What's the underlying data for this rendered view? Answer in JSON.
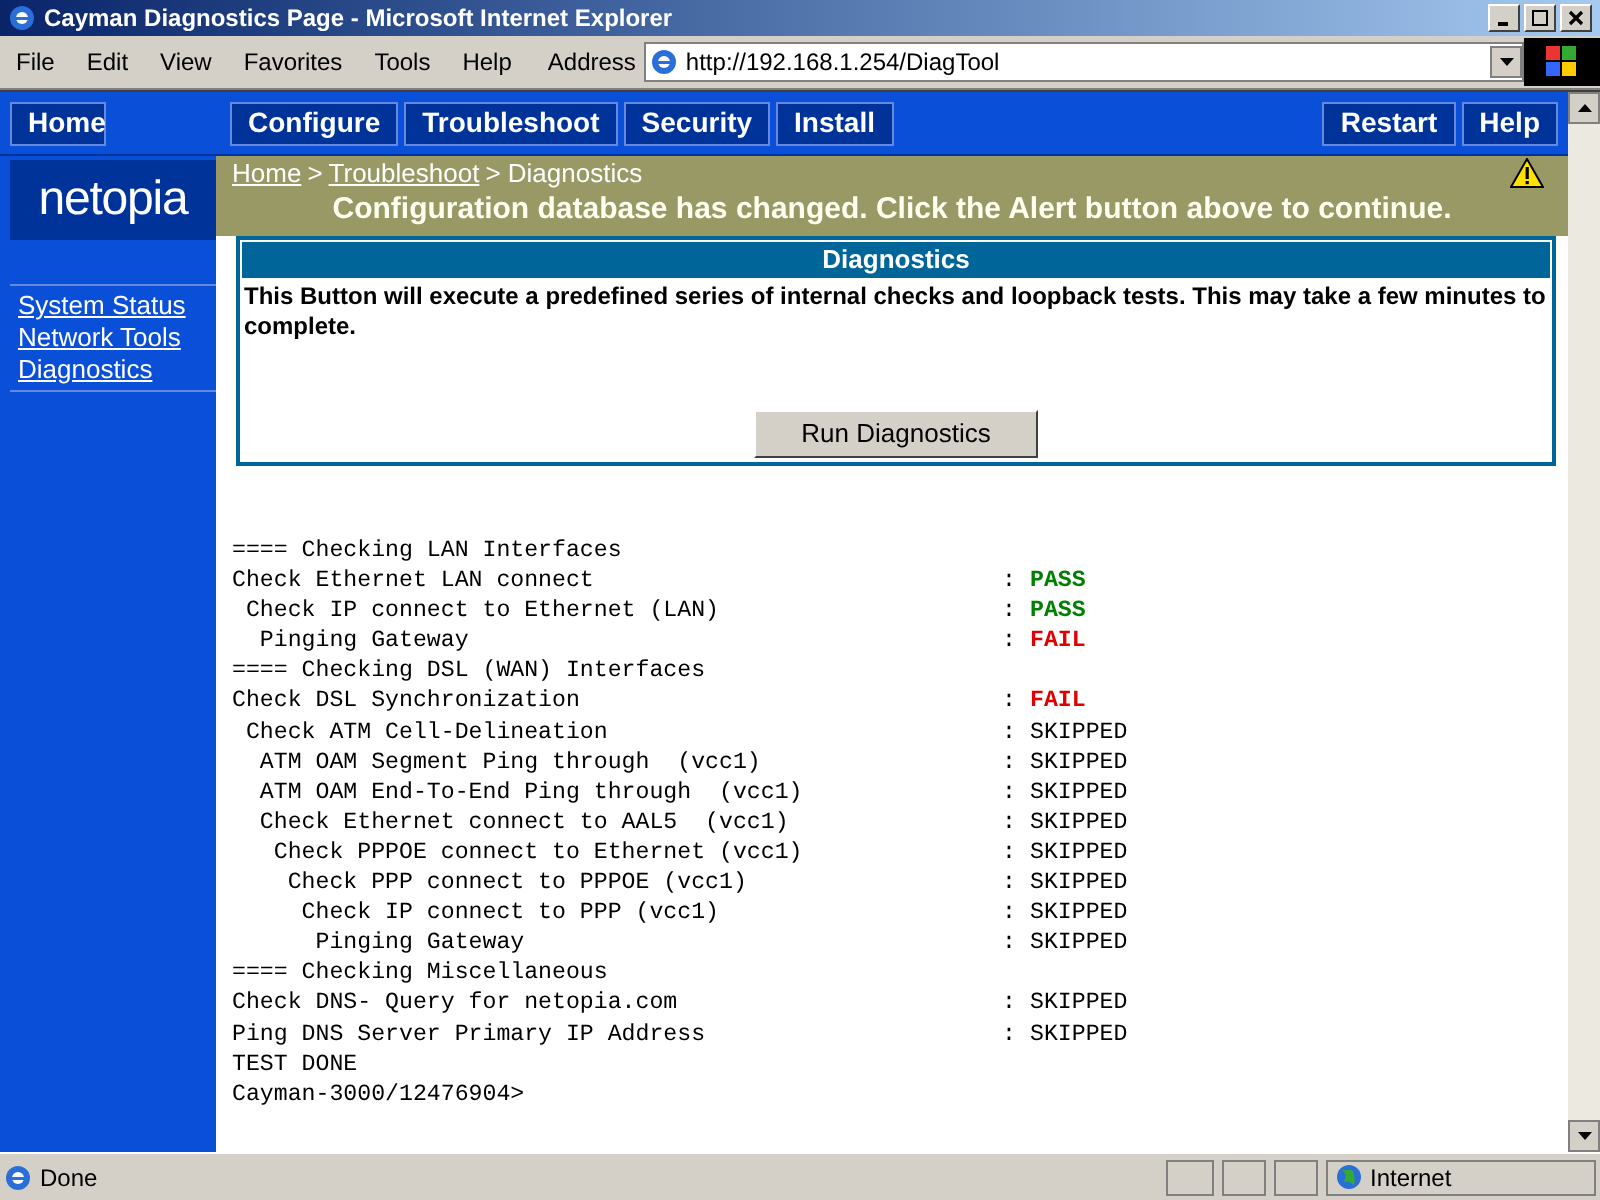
{
  "window": {
    "title": "Cayman Diagnostics Page - Microsoft Internet Explorer"
  },
  "menu": [
    "File",
    "Edit",
    "View",
    "Favorites",
    "Tools",
    "Help"
  ],
  "address": {
    "label": "Address",
    "value": "http://192.168.1.254/DiagTool"
  },
  "nav_left": [
    "Home"
  ],
  "nav_main": [
    "Configure",
    "Troubleshoot",
    "Security",
    "Install"
  ],
  "nav_right": [
    "Restart",
    "Help"
  ],
  "logo": "netopia",
  "sidebar": {
    "items": [
      "System Status",
      "Network Tools",
      "Diagnostics"
    ]
  },
  "breadcrumb": [
    {
      "text": "Home",
      "link": true
    },
    {
      "text": ">",
      "link": false
    },
    {
      "text": "Troubleshoot",
      "link": true
    },
    {
      "text": "> Diagnostics",
      "link": false
    }
  ],
  "alert": "Configuration database has changed. Click the Alert button above to continue.",
  "panel": {
    "title": "Diagnostics",
    "text": "This Button will execute a predefined series of internal checks and loopback tests. This may take a few minutes to complete.",
    "button": "Run Diagnostics"
  },
  "results": [
    {
      "text": "==== Checking LAN Interfaces"
    },
    {
      "text": "Check Ethernet LAN connect",
      "separator": ":",
      "status": "PASS",
      "kind": "pass"
    },
    {
      "text": " Check IP connect to Ethernet (LAN)",
      "separator": ":",
      "status": "PASS",
      "kind": "pass"
    },
    {
      "text": "  Pinging Gateway",
      "separator": ":",
      "status": "FAIL",
      "kind": "fail"
    },
    {
      "text": "==== Checking DSL (WAN) Interfaces"
    },
    {
      "text": "Check DSL Synchronization",
      "separator": ":",
      "status": "FAIL",
      "kind": "fail"
    },
    {
      "text": " Check ATM Cell-Delineation",
      "separator": ":",
      "status": "SKIPPED",
      "kind": "skipped"
    },
    {
      "text": "  ATM OAM Segment Ping through  (vcc1)",
      "separator": ":",
      "status": "SKIPPED",
      "kind": "skipped"
    },
    {
      "text": "  ATM OAM End-To-End Ping through  (vcc1)",
      "separator": ":",
      "status": "SKIPPED",
      "kind": "skipped"
    },
    {
      "text": "  Check Ethernet connect to AAL5  (vcc1)",
      "separator": ":",
      "status": "SKIPPED",
      "kind": "skipped"
    },
    {
      "text": "   Check PPPOE connect to Ethernet (vcc1)",
      "separator": ":",
      "status": "SKIPPED",
      "kind": "skipped"
    },
    {
      "text": "    Check PPP connect to PPPOE (vcc1)",
      "separator": ":",
      "status": "SKIPPED",
      "kind": "skipped"
    },
    {
      "text": "     Check IP connect to PPP (vcc1)",
      "separator": ":",
      "status": "SKIPPED",
      "kind": "skipped"
    },
    {
      "text": "      Pinging Gateway",
      "separator": ":",
      "status": "SKIPPED",
      "kind": "skipped"
    },
    {
      "text": "==== Checking Miscellaneous"
    },
    {
      "text": "Check DNS- Query for netopia.com",
      "separator": ":",
      "status": "SKIPPED",
      "kind": "skipped"
    },
    {
      "text": "Ping DNS Server Primary IP Address",
      "separator": ":",
      "status": "SKIPPED",
      "kind": "skipped"
    },
    {
      "text": "TEST DONE"
    },
    {
      "text": "Cayman-3000/12476904>"
    }
  ],
  "status_bar": {
    "text": "Done",
    "zone": "Internet"
  }
}
